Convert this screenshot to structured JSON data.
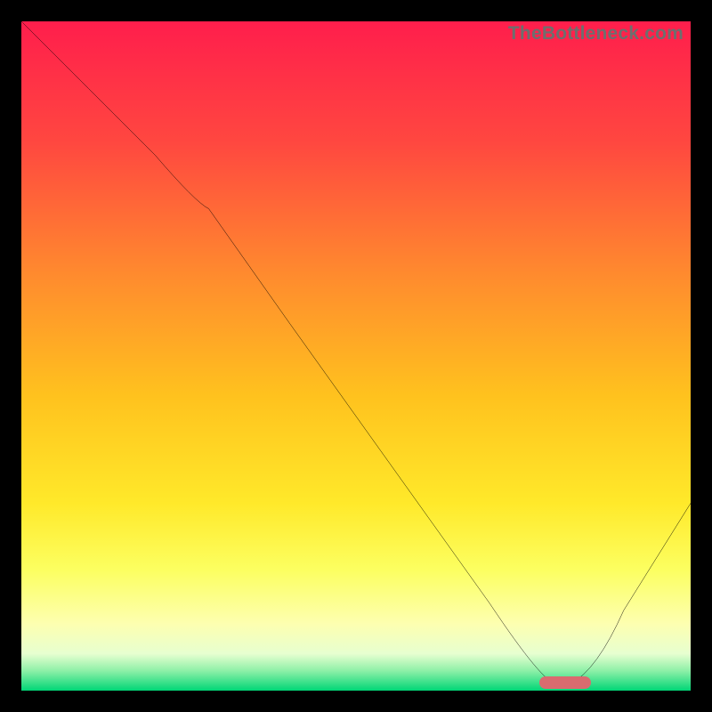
{
  "watermark": {
    "text": "TheBottleneck.com"
  },
  "colors": {
    "frame": "#000000",
    "gradient_stops": [
      {
        "offset": 0.0,
        "color": "#ff1e4c"
      },
      {
        "offset": 0.18,
        "color": "#ff4740"
      },
      {
        "offset": 0.38,
        "color": "#ff8b2e"
      },
      {
        "offset": 0.56,
        "color": "#ffc21e"
      },
      {
        "offset": 0.72,
        "color": "#ffe92a"
      },
      {
        "offset": 0.82,
        "color": "#fcff61"
      },
      {
        "offset": 0.9,
        "color": "#fdffb0"
      },
      {
        "offset": 0.945,
        "color": "#e7ffd0"
      },
      {
        "offset": 0.97,
        "color": "#8ff0a8"
      },
      {
        "offset": 1.0,
        "color": "#00d676"
      }
    ],
    "curve": "#000000",
    "marker": "#d96b6f"
  },
  "chart_data": {
    "type": "line",
    "title": "",
    "xlabel": "",
    "ylabel": "",
    "xlim": [
      0,
      100
    ],
    "ylim": [
      0,
      100
    ],
    "grid": false,
    "series": [
      {
        "name": "bottleneck-curve",
        "x": [
          0,
          10,
          20,
          28,
          40,
          55,
          70,
          80,
          82,
          90,
          100
        ],
        "y": [
          100,
          90,
          80,
          72,
          55,
          34,
          13,
          1,
          1,
          12,
          28
        ]
      }
    ],
    "marker": {
      "x_start": 78,
      "x_end": 85,
      "y": 0.8
    },
    "legend": []
  }
}
